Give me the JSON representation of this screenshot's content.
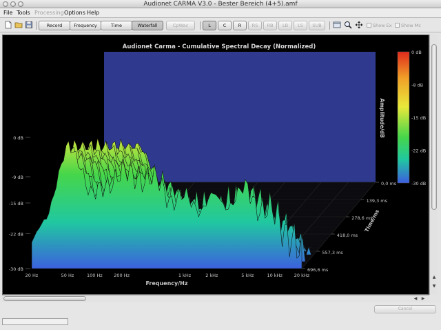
{
  "window": {
    "title": "Audionet CARMA V3.0 - Bester Bereich (4+5).amf"
  },
  "menubar": {
    "items": [
      {
        "label": "File",
        "enabled": true
      },
      {
        "label": "Tools",
        "enabled": true
      },
      {
        "label": "Processing",
        "enabled": false
      },
      {
        "label": "Options",
        "enabled": true
      },
      {
        "label": "Help",
        "enabled": true
      }
    ]
  },
  "toolbar": {
    "file_icons": [
      "new-document-icon",
      "open-folder-icon",
      "save-disk-icon"
    ],
    "view_buttons": [
      {
        "label": "Record",
        "state": "normal"
      },
      {
        "label": "Frequency",
        "state": "normal"
      },
      {
        "label": "Time",
        "state": "normal"
      },
      {
        "label": "Waterfall",
        "state": "active"
      },
      {
        "label": "CpWac",
        "state": "disabled"
      }
    ],
    "channel_buttons": [
      {
        "label": "L",
        "state": "active"
      },
      {
        "label": "C",
        "state": "normal"
      },
      {
        "label": "R",
        "state": "normal"
      },
      {
        "label": "RS",
        "state": "disabled"
      },
      {
        "label": "RB",
        "state": "disabled"
      },
      {
        "label": "LB",
        "state": "disabled"
      },
      {
        "label": "LS",
        "state": "disabled"
      },
      {
        "label": "SUB",
        "state": "disabled"
      }
    ],
    "tool_icons": [
      "window-layout-icon",
      "zoom-magnifier-icon",
      "move-arrows-icon"
    ],
    "checkboxes": [
      {
        "label": "Show Ex",
        "checked": false,
        "enabled": false
      },
      {
        "label": "Show Mc",
        "checked": false,
        "enabled": false
      }
    ]
  },
  "chart_data": {
    "type": "waterfall",
    "title": "Audionet Carma - Cumulative Spectral Decay (Normalized)",
    "xlabel": "Frequency/Hz",
    "ylabel": "Amplitude/dB",
    "zlabel": "Time/ms",
    "x_ticks": [
      "20 Hz",
      "50 Hz",
      "100 Hz",
      "200 Hz",
      "1 kHz",
      "2 kHz",
      "5 kHz",
      "10 kHz",
      "20 kHz"
    ],
    "y_ticks": [
      "0 dB",
      "-9 dB",
      "-15 dB",
      "-22 dB",
      "-30 dB"
    ],
    "z_ticks": [
      "0,0 ms",
      "139,3 ms",
      "278,6 ms",
      "418,0 ms",
      "557,3 ms",
      "696,6 ms"
    ],
    "colorbar_ticks": [
      "0 dB",
      "-8 dB",
      "-15 dB",
      "-22 dB",
      "-30 dB"
    ],
    "x_scale": "log",
    "y_range_db": [
      -30,
      0
    ],
    "z_range_ms": [
      0,
      696.6
    ],
    "colormap": [
      "#e02a1c",
      "#f0a028",
      "#e8e83a",
      "#46d64a",
      "#20c8a0",
      "#3c5ee0"
    ],
    "panel_color": "#2f3a8f",
    "background": "#000000",
    "n_slices": 26,
    "profile_freq_hz": [
      20,
      30,
      40,
      50,
      60,
      70,
      80,
      90,
      100,
      120,
      150,
      200,
      300,
      500,
      700,
      1000,
      1500,
      2000,
      3000,
      5000,
      7000,
      10000,
      15000,
      20000
    ],
    "profile_db": [
      -24,
      -18,
      -8,
      -2,
      -4,
      -6,
      -10,
      -13,
      -13,
      -12,
      -10,
      -8,
      -9,
      -10,
      -14,
      -14,
      -16,
      -14,
      -15,
      -12,
      -16,
      -18,
      -22,
      -28
    ]
  },
  "status": {
    "cancel_label": "Cancel"
  }
}
